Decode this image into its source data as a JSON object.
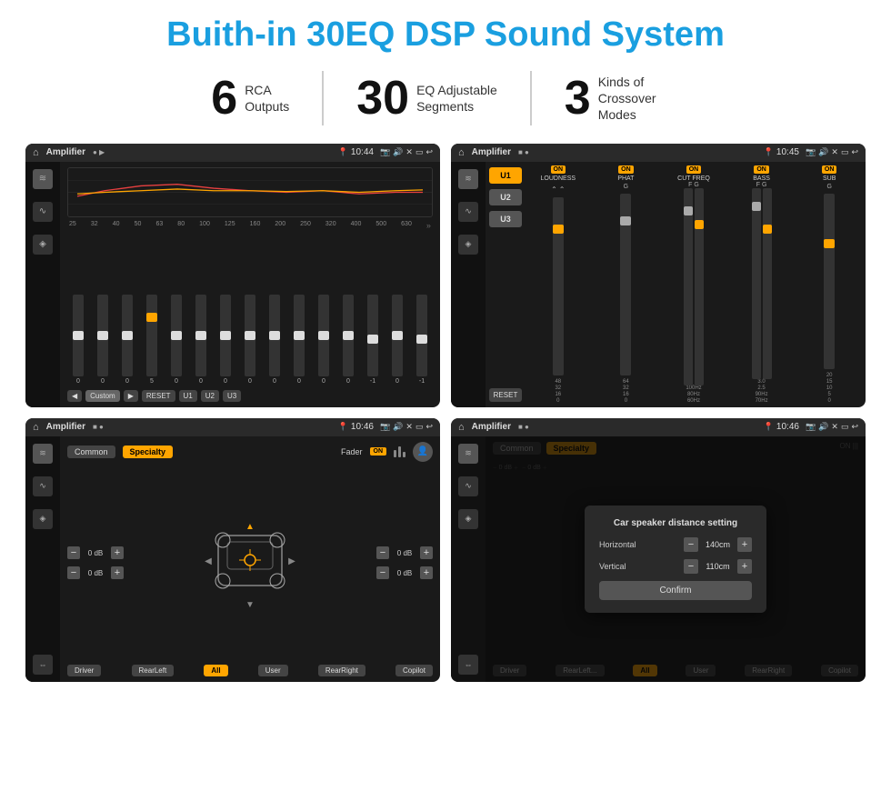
{
  "header": {
    "title": "Buith-in 30EQ DSP Sound System"
  },
  "stats": [
    {
      "number": "6",
      "label": "RCA\nOutputs"
    },
    {
      "number": "30",
      "label": "EQ Adjustable\nSegments"
    },
    {
      "number": "3",
      "label": "Kinds of\nCrossover Modes"
    }
  ],
  "screen_top_left": {
    "status_bar": {
      "app": "Amplifier",
      "time": "10:44"
    },
    "eq_freqs": [
      "25",
      "32",
      "40",
      "50",
      "63",
      "80",
      "100",
      "125",
      "160",
      "200",
      "250",
      "320",
      "400",
      "500",
      "630"
    ],
    "eq_values": [
      "0",
      "0",
      "0",
      "5",
      "0",
      "0",
      "0",
      "0",
      "0",
      "0",
      "0",
      "0",
      "-1",
      "0",
      "-1"
    ],
    "buttons": [
      "Custom",
      "RESET",
      "U1",
      "U2",
      "U3"
    ]
  },
  "screen_top_right": {
    "status_bar": {
      "app": "Amplifier",
      "time": "10:45"
    },
    "u_buttons": [
      "U1",
      "U2",
      "U3"
    ],
    "channels": [
      {
        "name": "LOUDNESS",
        "on": true
      },
      {
        "name": "PHAT",
        "on": true
      },
      {
        "name": "CUT FREQ",
        "on": true
      },
      {
        "name": "BASS",
        "on": true
      },
      {
        "name": "SUB",
        "on": true
      }
    ],
    "reset_label": "RESET"
  },
  "screen_bottom_left": {
    "status_bar": {
      "app": "Amplifier",
      "time": "10:46"
    },
    "tabs": [
      "Common",
      "Specialty"
    ],
    "fader_label": "Fader",
    "fader_on": "ON",
    "vol_rows": [
      {
        "label": "0 dB"
      },
      {
        "label": "0 dB"
      },
      {
        "label": "0 dB"
      },
      {
        "label": "0 dB"
      }
    ],
    "bottom_btns": [
      "Driver",
      "RearLeft",
      "All",
      "User",
      "RearRight",
      "Copilot"
    ]
  },
  "screen_bottom_right": {
    "status_bar": {
      "app": "Amplifier",
      "time": "10:46"
    },
    "tabs": [
      "Common",
      "Specialty"
    ],
    "dialog": {
      "title": "Car speaker distance setting",
      "horizontal_label": "Horizontal",
      "horizontal_value": "140cm",
      "vertical_label": "Vertical",
      "vertical_value": "110cm",
      "confirm_label": "Confirm"
    },
    "bottom_btns": [
      "Driver",
      "RearLeft",
      "All",
      "User",
      "RearRight",
      "Copilot"
    ]
  },
  "icons": {
    "home": "⌂",
    "location_pin": "📍",
    "camera": "📷",
    "volume": "🔊",
    "back": "↩",
    "eq_icon": "≋",
    "wave_icon": "∿",
    "speaker_icon": "◈",
    "settings_icon": "⚙",
    "user_icon": "👤",
    "chevron_right": "❯",
    "chevron_left": "❮",
    "chevron_up": "▲",
    "chevron_down": "▼",
    "minus": "−",
    "plus": "+"
  }
}
